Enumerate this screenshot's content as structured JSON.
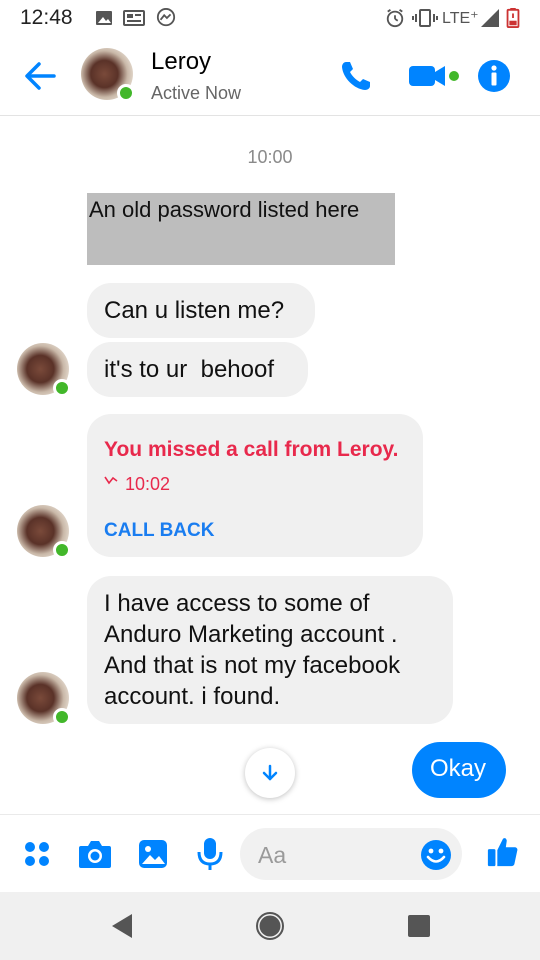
{
  "status_bar": {
    "time": "12:48",
    "network": "LTE⁺"
  },
  "header": {
    "contact_name": "Leroy",
    "contact_status": "Active Now",
    "accent": "#0084ff",
    "online_color": "#42b72a"
  },
  "chat": {
    "timestamp": "10:00",
    "redacted_message": "An old password listed here",
    "messages": [
      {
        "text": "Can u listen me?"
      },
      {
        "text": "it's to ur  behoof"
      }
    ],
    "missed_call": {
      "title": "You missed a call from Leroy.",
      "time": "10:02",
      "action": "CALL BACK",
      "title_color": "#e8294c",
      "action_color": "#1a7df0"
    },
    "long_message": {
      "lines": [
        "I have access to some of",
        "Anduro Marketing account .",
        "And that is not my facebook",
        "account. i found."
      ]
    },
    "outgoing": {
      "text": "Okay"
    }
  },
  "composer": {
    "placeholder": "Aa"
  }
}
